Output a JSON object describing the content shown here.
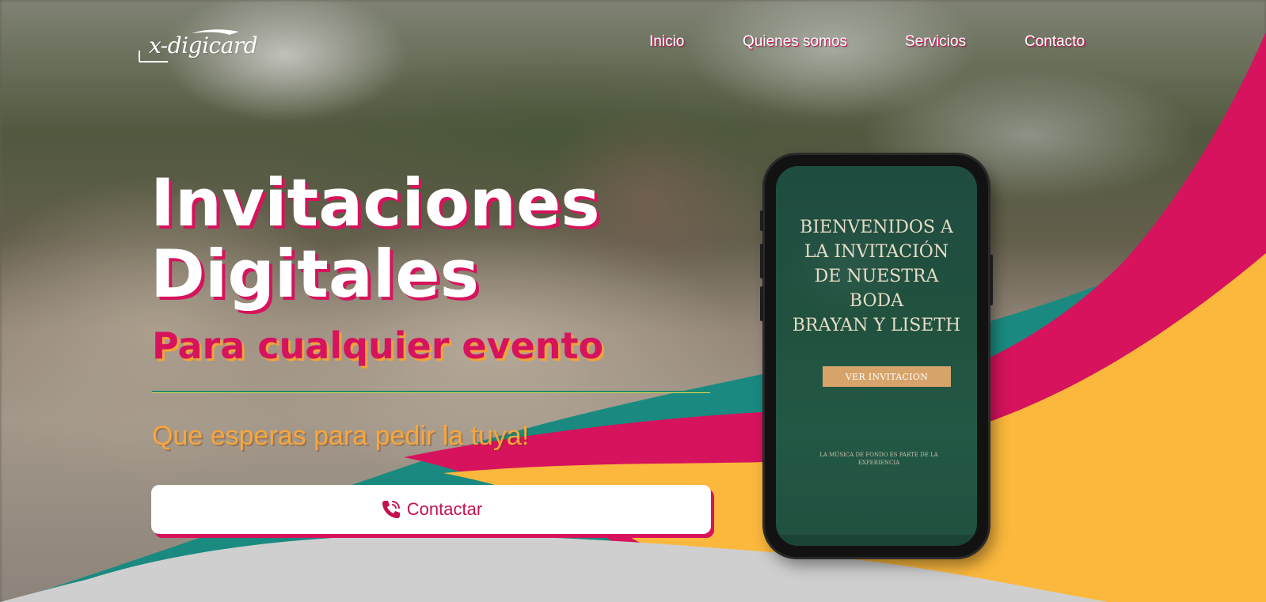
{
  "brand": {
    "logo_text": "x-digicard"
  },
  "nav": {
    "items": [
      {
        "label": "Inicio"
      },
      {
        "label": "Quienes somos"
      },
      {
        "label": "Servicios"
      },
      {
        "label": "Contacto"
      }
    ]
  },
  "hero": {
    "title_line1": "Invitaciones",
    "title_line2": "Digitales",
    "subtitle": "Para cualquier evento",
    "tagline": "Que esperas para pedir la tuya!",
    "cta_label": "Contactar",
    "cta_icon": "phone-call-icon"
  },
  "phone_preview": {
    "welcome_lines": [
      "BIENVENIDOS A",
      "LA INVITACIÓN",
      "DE NUESTRA",
      "BODA",
      "BRAYAN Y LISETH"
    ],
    "button_label": "VER INVITACION",
    "music_note": "LA MÚSICA DE FONDO ES PARTE DE LA EXPERIENCIA"
  },
  "colors": {
    "magenta": "#d6135c",
    "teal": "#1a8a80",
    "yellow": "#fcb83d",
    "grey": "#cfcfcf",
    "orange_text": "#f7a63b",
    "phone_screen": "#21513f"
  }
}
